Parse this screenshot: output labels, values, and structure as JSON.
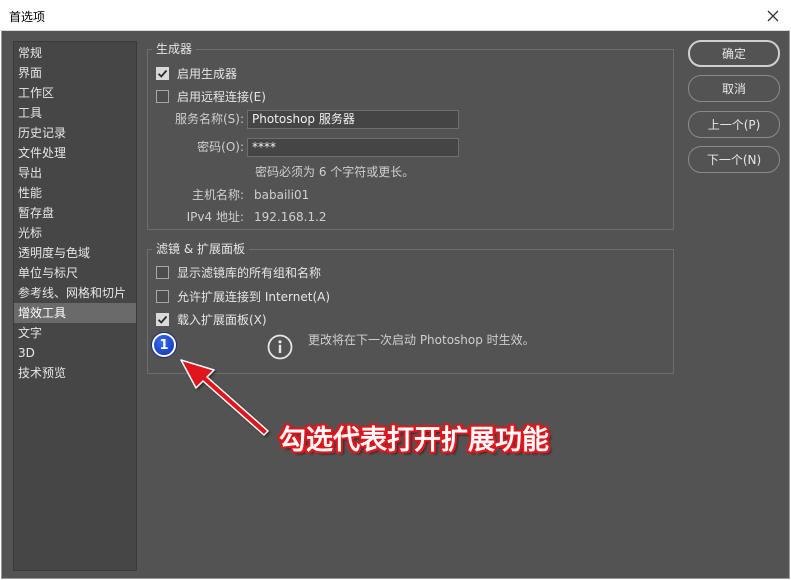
{
  "window": {
    "title": "首选项",
    "close_icon": "close-icon"
  },
  "sidebar": {
    "items": [
      {
        "label": "常规"
      },
      {
        "label": "界面"
      },
      {
        "label": "工作区"
      },
      {
        "label": "工具"
      },
      {
        "label": "历史记录"
      },
      {
        "label": "文件处理"
      },
      {
        "label": "导出"
      },
      {
        "label": "性能"
      },
      {
        "label": "暂存盘"
      },
      {
        "label": "光标"
      },
      {
        "label": "透明度与色域"
      },
      {
        "label": "单位与标尺"
      },
      {
        "label": "参考线、网格和切片"
      },
      {
        "label": "增效工具",
        "active": true
      },
      {
        "label": "文字"
      },
      {
        "label": "3D"
      },
      {
        "label": "技术预览"
      }
    ]
  },
  "generator": {
    "title": "生成器",
    "enable_label": "启用生成器",
    "enable_checked": true,
    "remote_label": "启用远程连接(E)",
    "remote_checked": false,
    "service_name_label": "服务名称(S):",
    "service_name_value": "Photoshop 服务器",
    "password_label": "密码(O):",
    "password_value": "****",
    "password_hint": "密码必须为 6 个字符或更长。",
    "host_label": "主机名称:",
    "host_value": "babaili01",
    "ipv4_label": "IPv4 地址:",
    "ipv4_value": "192.168.1.2"
  },
  "filters": {
    "title": "滤镜 & 扩展面板",
    "show_all_label": "显示滤镜库的所有组和名称",
    "show_all_checked": false,
    "allow_ext_label": "允许扩展连接到 Internet(A)",
    "allow_ext_checked": false,
    "load_panels_label": "载入扩展面板(X)",
    "load_panels_checked": true,
    "restart_note": "更改将在下一次启动 Photoshop 时生效。"
  },
  "buttons": {
    "ok": "确定",
    "cancel": "取消",
    "prev": "上一个(P)",
    "next": "下一个(N)"
  },
  "annotation": {
    "badge": "1",
    "callout": "勾选代表打开扩展功能",
    "color": "#e0161d"
  }
}
